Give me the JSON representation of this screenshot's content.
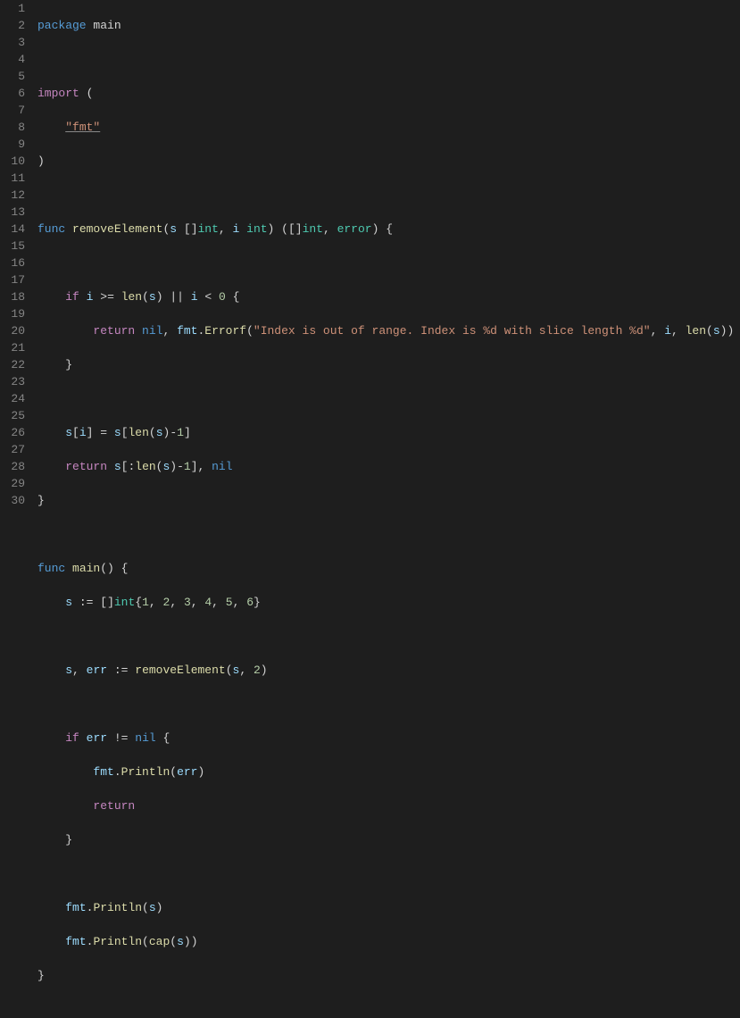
{
  "lineCount": 30,
  "tokens": {
    "package": "package",
    "main": "main",
    "import": "import",
    "fmt_str": "\"fmt\"",
    "func": "func",
    "removeElement": "removeElement",
    "s": "s",
    "i": "i",
    "int": "int",
    "error": "error",
    "if": "if",
    "len": "len",
    "or": "||",
    "lt": "<",
    "ge": ">=",
    "zero": "0",
    "return": "return",
    "nil": "nil",
    "Errorf": "Errorf",
    "fmt_pkg": "fmt",
    "errmsg": "\"Index is out of range. Index is %d with slice length %d\"",
    "one": "1",
    "main_fn": "main",
    "decl": ":=",
    "slice_nums": [
      "1",
      "2",
      "3",
      "4",
      "5",
      "6"
    ],
    "two": "2",
    "err": "err",
    "ne": "!=",
    "Println": "Println",
    "cap": "cap"
  }
}
